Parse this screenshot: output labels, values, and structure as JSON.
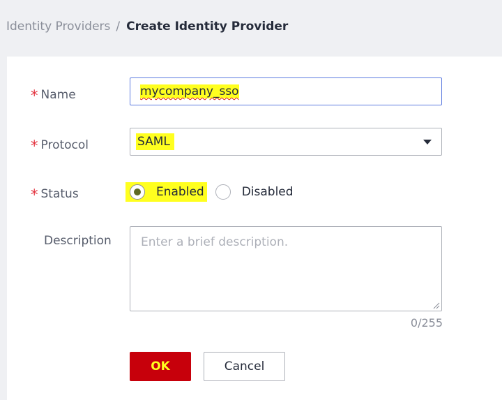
{
  "breadcrumb": {
    "parent": "Identity Providers",
    "separator": "/",
    "current": "Create Identity Provider"
  },
  "form": {
    "name": {
      "label": "Name",
      "required_mark": "*",
      "value": "mycompany_sso"
    },
    "protocol": {
      "label": "Protocol",
      "required_mark": "*",
      "selected": "SAML"
    },
    "status": {
      "label": "Status",
      "required_mark": "*",
      "options": [
        "Enabled",
        "Disabled"
      ],
      "selected": "Enabled"
    },
    "description": {
      "label": "Description",
      "placeholder": "Enter a brief description.",
      "value": "",
      "counter": "0/255"
    }
  },
  "actions": {
    "ok_label": "OK",
    "cancel_label": "Cancel"
  },
  "colors": {
    "primary_button": "#c7000b",
    "highlight": "#ffff1f",
    "input_focus_border": "#5e7ce0",
    "required_asterisk": "#e3333f"
  },
  "icons": {
    "dropdown": "chevron-down-icon",
    "resize": "resize-grip-icon"
  }
}
